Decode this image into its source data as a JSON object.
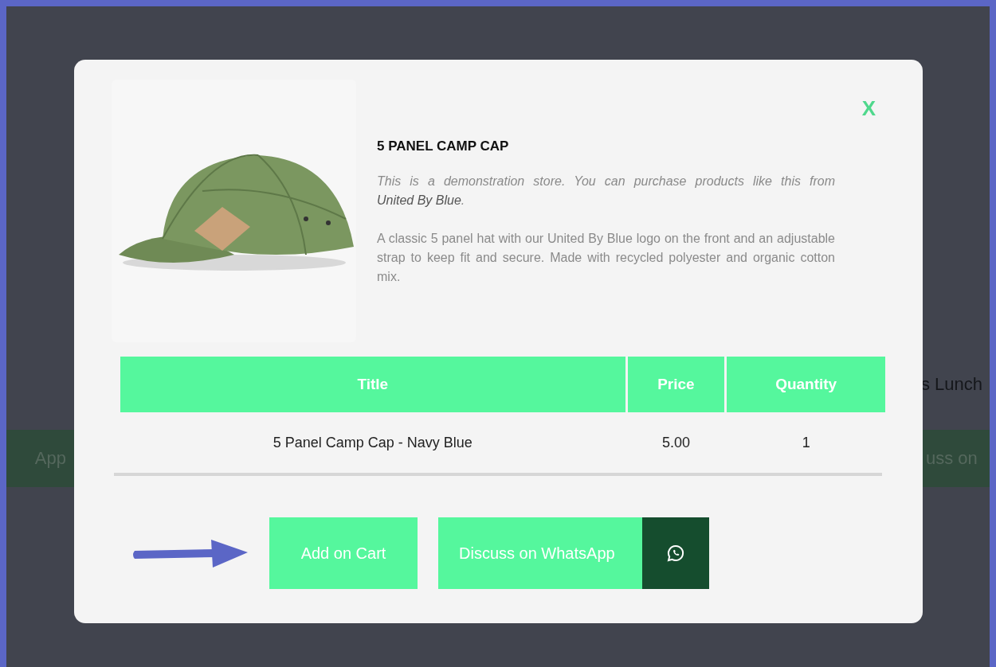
{
  "background": {
    "left_button": "App",
    "right_heading": "s Lunch",
    "right_button": "uss on"
  },
  "modal": {
    "close": "X",
    "product": {
      "title": "5 PANEL CAMP CAP",
      "note": {
        "text": "This is a demonstration store. You can purchase products like this from",
        "link": "United By Blue",
        "end": "."
      },
      "description": "A classic 5 panel hat with our United By Blue logo on the front and an adjustable strap to keep fit and secure. Made with recycled polyester and organic cotton mix."
    },
    "table": {
      "columns": [
        "Title",
        "Price",
        "Quantity"
      ],
      "rows": [
        [
          "5 Panel Camp Cap - Navy Blue",
          "5.00",
          "1"
        ]
      ]
    },
    "buttons": [
      {
        "kind": "cart",
        "label": "Add on Cart"
      },
      {
        "kind": "whatsapp",
        "label": "Discuss on WhatsApp"
      }
    ]
  }
}
